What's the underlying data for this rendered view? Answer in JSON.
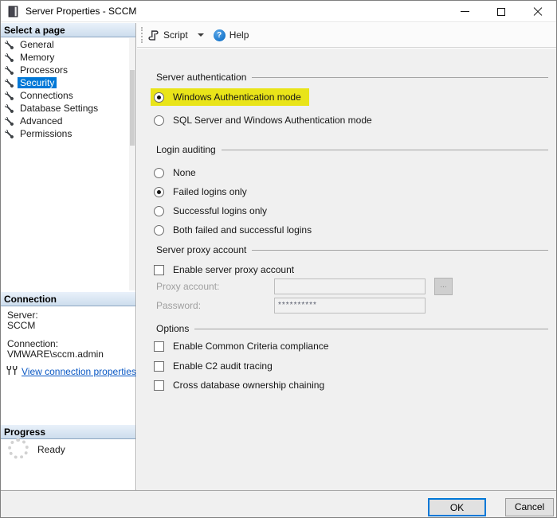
{
  "window": {
    "title": "Server Properties - SCCM"
  },
  "icons": {
    "help_glyph": "?"
  },
  "toolbar": {
    "script_label": "Script",
    "help_label": "Help"
  },
  "sidebar": {
    "pages_header": "Select a page",
    "pages": [
      {
        "label": "General",
        "selected": false
      },
      {
        "label": "Memory",
        "selected": false
      },
      {
        "label": "Processors",
        "selected": false
      },
      {
        "label": "Security",
        "selected": true
      },
      {
        "label": "Connections",
        "selected": false
      },
      {
        "label": "Database Settings",
        "selected": false
      },
      {
        "label": "Advanced",
        "selected": false
      },
      {
        "label": "Permissions",
        "selected": false
      }
    ],
    "connection": {
      "header": "Connection",
      "server_label": "Server:",
      "server_value": "SCCM",
      "connection_label": "Connection:",
      "connection_value": "VMWARE\\sccm.admin",
      "link": "View connection properties"
    },
    "progress": {
      "header": "Progress",
      "status": "Ready"
    }
  },
  "main": {
    "server_authentication": {
      "title": "Server authentication",
      "options": [
        {
          "label": "Windows Authentication mode",
          "selected": true,
          "highlighted": true
        },
        {
          "label": "SQL Server and Windows Authentication mode",
          "selected": false,
          "highlighted": false
        }
      ]
    },
    "login_auditing": {
      "title": "Login auditing",
      "options": [
        {
          "label": "None",
          "selected": false
        },
        {
          "label": "Failed logins only",
          "selected": true
        },
        {
          "label": "Successful logins only",
          "selected": false
        },
        {
          "label": "Both failed and successful logins",
          "selected": false
        }
      ]
    },
    "server_proxy_account": {
      "title": "Server proxy account",
      "enable_label": "Enable server proxy account",
      "enable_checked": false,
      "proxy_account_label": "Proxy account:",
      "proxy_account_value": "",
      "browse_label": "...",
      "password_label": "Password:",
      "password_value": "**********"
    },
    "options_section": {
      "title": "Options",
      "checkboxes": [
        {
          "label": "Enable Common Criteria compliance",
          "checked": false
        },
        {
          "label": "Enable C2 audit tracing",
          "checked": false
        },
        {
          "label": "Cross database ownership chaining",
          "checked": false
        }
      ]
    }
  },
  "footer": {
    "ok": "OK",
    "cancel": "Cancel"
  },
  "colors": {
    "selection": "#0078d7",
    "highlight": "#e9e419",
    "link": "#0a58c4",
    "help_icon": "#1c79cd"
  }
}
